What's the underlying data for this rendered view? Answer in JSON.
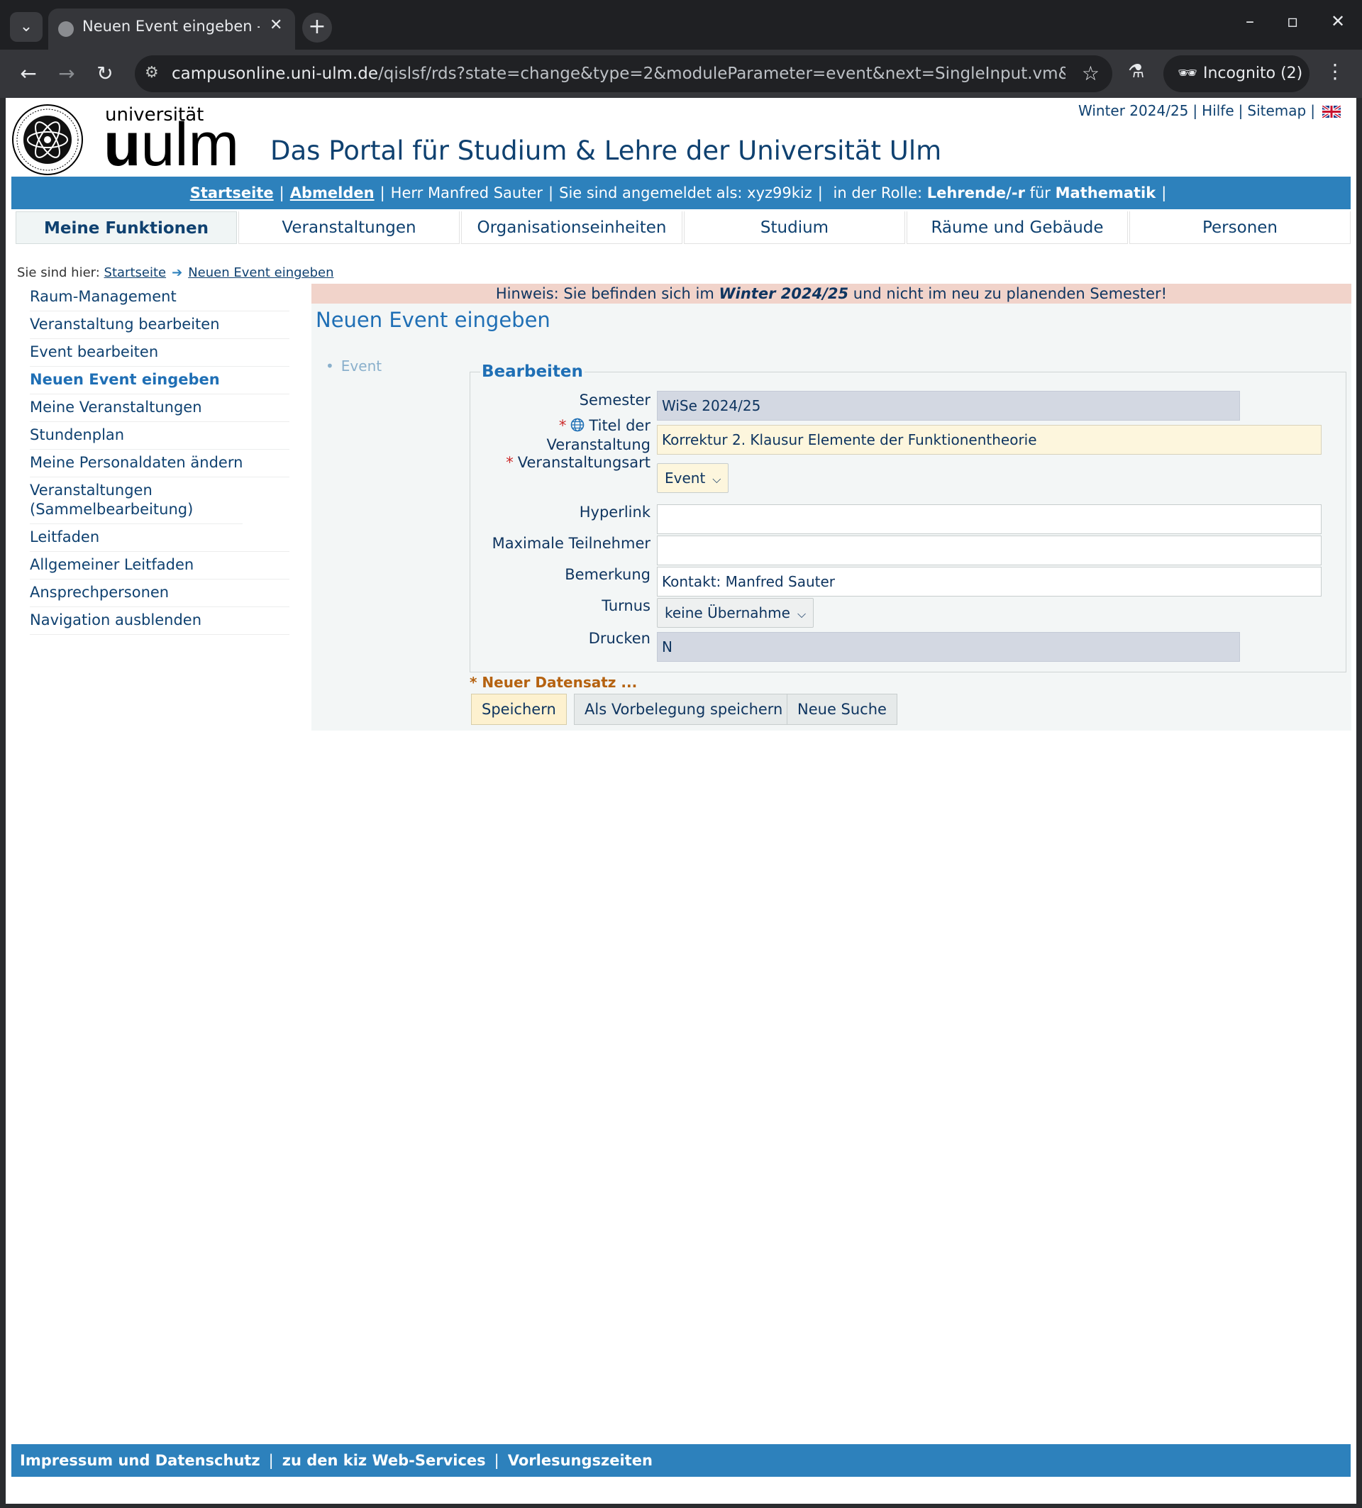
{
  "browser": {
    "tab_title": "Neuen Event eingeben - Universität Ulm",
    "url_host": "campusonline.uni-ulm.de",
    "url_path": "/qislsf/rds?state=change&type=2&moduleParameter=event&next=SingleInput.vm&sqlmod...",
    "incognito_label": "Incognito (2)"
  },
  "header": {
    "brand_small": "universität",
    "brand_big_1": "u",
    "brand_big_2": "ulm",
    "portal_title": "Das Portal für Studium & Lehre der Universität Ulm",
    "toplinks": [
      "Winter 2024/25",
      "Hilfe",
      "Sitemap"
    ]
  },
  "userbar": {
    "startseite": "Startseite",
    "abmelden": "Abmelden",
    "user": "Herr Manfred Sauter",
    "logged_as": "Sie sind angemeldet als: xyz99kiz",
    "role_prefix": "in der Rolle:",
    "role": "Lehrende/-r",
    "role_for": "für",
    "faculty": "Mathematik"
  },
  "mainnav": [
    "Meine Funktionen",
    "Veranstaltungen",
    "Organisationseinheiten",
    "Studium",
    "Räume und Gebäude",
    "Personen"
  ],
  "breadcrumb": {
    "prefix": "Sie sind hier:",
    "items": [
      "Startseite",
      "Neuen Event eingeben"
    ]
  },
  "sidebar": [
    "Raum-Management",
    "Veranstaltung bearbeiten",
    "Event bearbeiten",
    "Neuen Event eingeben",
    "Meine Veranstaltungen",
    "Stundenplan",
    "Meine Personaldaten ändern",
    "Veranstaltungen (Sammelbearbeitung)",
    "Leitfaden",
    "Allgemeiner Leitfaden",
    "Ansprechpersonen",
    "Navigation ausblenden"
  ],
  "content": {
    "hint_pre": "Hinweis: Sie befinden sich im",
    "hint_sem": "Winter 2024/25",
    "hint_post": "und nicht im neu zu planenden Semester!",
    "heading": "Neuen Event eingeben",
    "subnav": "Event",
    "legend": "Bearbeiten",
    "form": {
      "semester_label": "Semester",
      "semester_value": "WiSe 2024/25",
      "titel_label_1": "Titel der",
      "titel_label_2": "Veranstaltung",
      "titel_value": "Korrektur 2. Klausur Elemente der Funktionentheorie",
      "art_label": "Veranstaltungsart",
      "art_value": "Event",
      "hyperlink_label": "Hyperlink",
      "hyperlink_value": "",
      "max_label": "Maximale Teilnehmer",
      "max_value": "",
      "bemerkung_label": "Bemerkung",
      "bemerkung_value": "Kontakt: Manfred Sauter",
      "turnus_label": "Turnus",
      "turnus_value": "keine Übernahme",
      "drucken_label": "Drucken",
      "drucken_value": "N"
    },
    "new_record": "* Neuer Datensatz ...",
    "buttons": {
      "save": "Speichern",
      "save_default": "Als Vorbelegung speichern",
      "new_search": "Neue Suche"
    }
  },
  "footer": [
    "Impressum und Datenschutz",
    "zu den kiz Web-Services",
    "Vorlesungszeiten"
  ],
  "colors": {
    "brand_blue": "#2d81bc",
    "text_navy": "#0f4170",
    "hint_bg": "#f1d3ca"
  }
}
